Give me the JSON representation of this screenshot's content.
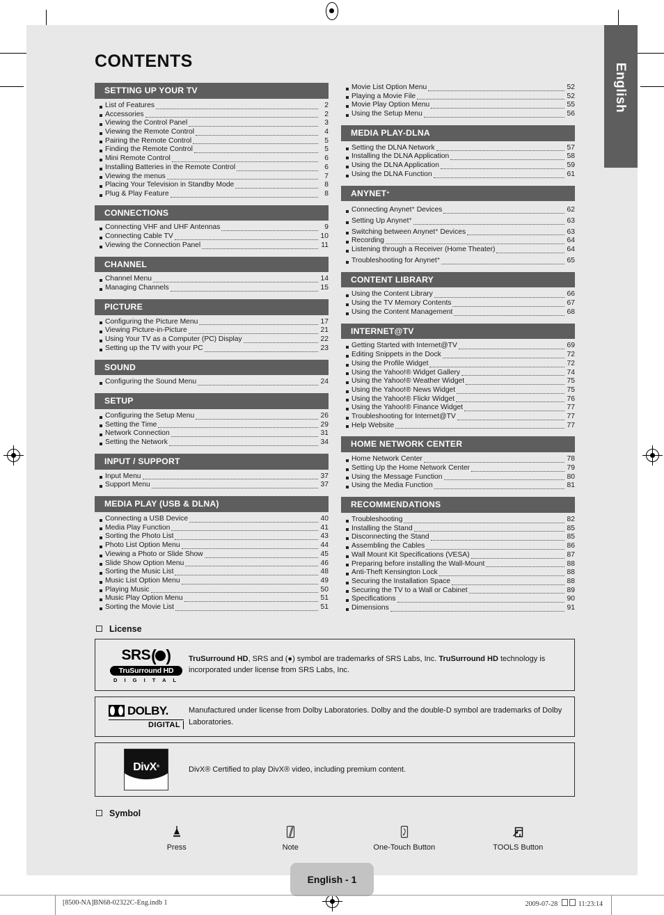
{
  "page": {
    "title": "CONTENTS",
    "language_tab": "English",
    "page_badge": "English - 1"
  },
  "print_footer": {
    "file": "[8500-NA]BN68-02322C-Eng.indb   1",
    "timestamp": "2009-07-28",
    "time": "11:23:14"
  },
  "toc": {
    "left_sections": [
      {
        "heading": "SETTING UP YOUR TV",
        "entries": [
          {
            "label": "List of Features",
            "page": "2"
          },
          {
            "label": "Accessories",
            "page": "2"
          },
          {
            "label": "Viewing the Control Panel",
            "page": "3"
          },
          {
            "label": "Viewing the Remote Control",
            "page": "4"
          },
          {
            "label": "Pairing the Remote Control",
            "page": "5"
          },
          {
            "label": "Finding the Remote Control",
            "page": "5"
          },
          {
            "label": "Mini Remote Control",
            "page": "6"
          },
          {
            "label": "Installing Batteries in the Remote Control",
            "page": "6"
          },
          {
            "label": "Viewing the menus",
            "page": "7"
          },
          {
            "label": "Placing Your Television in Standby Mode",
            "page": "8"
          },
          {
            "label": "Plug & Play Feature",
            "page": "8"
          }
        ]
      },
      {
        "heading": "CONNECTIONS",
        "entries": [
          {
            "label": "Connecting VHF and UHF Antennas",
            "page": "9"
          },
          {
            "label": "Connecting Cable TV",
            "page": "10"
          },
          {
            "label": "Viewing the Connection Panel",
            "page": "11"
          }
        ]
      },
      {
        "heading": "CHANNEL",
        "entries": [
          {
            "label": "Channel Menu",
            "page": "14"
          },
          {
            "label": "Managing Channels",
            "page": "15"
          }
        ]
      },
      {
        "heading": "PICTURE",
        "entries": [
          {
            "label": "Configuring the Picture Menu",
            "page": "17"
          },
          {
            "label": "Viewing Picture-in-Picture",
            "page": "21"
          },
          {
            "label": "Using Your TV as a Computer (PC) Display",
            "page": "22"
          },
          {
            "label": "Setting up the TV with your PC",
            "page": "23"
          }
        ]
      },
      {
        "heading": "SOUND",
        "entries": [
          {
            "label": "Configuring the Sound Menu",
            "page": "24"
          }
        ]
      },
      {
        "heading": "SETUP",
        "entries": [
          {
            "label": "Configuring the Setup Menu",
            "page": "26"
          },
          {
            "label": "Setting the Time",
            "page": "29"
          },
          {
            "label": "Network Connection",
            "page": "31"
          },
          {
            "label": "Setting the Network",
            "page": "34"
          }
        ]
      },
      {
        "heading": "INPUT / SUPPORT",
        "entries": [
          {
            "label": "Input Menu",
            "page": "37"
          },
          {
            "label": "Support Menu",
            "page": "37"
          }
        ]
      },
      {
        "heading": "MEDIA PLAY (USB & DLNA)",
        "entries": [
          {
            "label": "Connecting a USB Device",
            "page": "40"
          },
          {
            "label": "Media Play Function",
            "page": "41"
          },
          {
            "label": "Sorting the Photo List",
            "page": "43"
          },
          {
            "label": "Photo List Option Menu",
            "page": "44"
          },
          {
            "label": "Viewing a Photo or Slide Show",
            "page": "45"
          },
          {
            "label": "Slide Show Option Menu",
            "page": "46"
          },
          {
            "label": "Sorting the Music List",
            "page": "48"
          },
          {
            "label": "Music List Option Menu",
            "page": "49"
          },
          {
            "label": "Playing Music",
            "page": "50"
          },
          {
            "label": "Music Play Option Menu",
            "page": "51"
          },
          {
            "label": "Sorting the Movie List",
            "page": "51"
          }
        ]
      }
    ],
    "right_sections": [
      {
        "heading": null,
        "entries": [
          {
            "label": "Movie List Option Menu",
            "page": "52"
          },
          {
            "label": "Playing a Movie File",
            "page": "52"
          },
          {
            "label": "Movie Play Option Menu",
            "page": "55"
          },
          {
            "label": "Using the Setup Menu",
            "page": "56"
          }
        ]
      },
      {
        "heading": "MEDIA PLAY-DLNA",
        "entries": [
          {
            "label": "Setting the DLNA Network",
            "page": "57"
          },
          {
            "label": "Installing the DLNA Application",
            "page": "58"
          },
          {
            "label": "Using the DLNA Application",
            "page": "59"
          },
          {
            "label": "Using the DLNA Function",
            "page": "61"
          }
        ]
      },
      {
        "heading": "ANYNET+",
        "heading_sup": true,
        "entries": [
          {
            "label": "Connecting Anynet",
            "sup": "+",
            "label2": " Devices",
            "page": "62"
          },
          {
            "label": "Setting Up Anynet",
            "sup": "+",
            "label2": "",
            "page": "63"
          },
          {
            "label": "Switching between Anynet",
            "sup": "+",
            "label2": " Devices",
            "page": "63"
          },
          {
            "label": "Recording",
            "page": "64"
          },
          {
            "label": "Listening through a Receiver (Home Theater)",
            "page": "64"
          },
          {
            "label": "Troubleshooting for Anynet",
            "sup": "+",
            "label2": "",
            "page": "65"
          }
        ]
      },
      {
        "heading": "CONTENT LIBRARY",
        "entries": [
          {
            "label": "Using the Content Library",
            "page": "66"
          },
          {
            "label": "Using the TV Memory Contents",
            "page": "67"
          },
          {
            "label": "Using the Content Management",
            "page": "68"
          }
        ]
      },
      {
        "heading": "INTERNET@TV",
        "entries": [
          {
            "label": "Getting Started with Internet@TV",
            "page": "69"
          },
          {
            "label": "Editing Snippets in the Dock",
            "page": "72"
          },
          {
            "label": "Using the Profile Widget",
            "page": "72"
          },
          {
            "label": "Using the Yahoo!® Widget Gallery",
            "page": "74"
          },
          {
            "label": "Using the Yahoo!® Weather Widget",
            "page": "75"
          },
          {
            "label": "Using the Yahoo!® News Widget",
            "page": "75"
          },
          {
            "label": "Using the Yahoo!® Flickr Widget",
            "page": "76"
          },
          {
            "label": "Using the Yahoo!® Finance Widget",
            "page": "77"
          },
          {
            "label": "Troubleshooting for Internet@TV",
            "page": "77"
          },
          {
            "label": "Help Website",
            "page": "77"
          }
        ]
      },
      {
        "heading": "HOME NETWORK CENTER",
        "entries": [
          {
            "label": "Home Network Center",
            "page": "78"
          },
          {
            "label": "Setting Up the Home Network Center",
            "page": "79"
          },
          {
            "label": "Using the Message Function",
            "page": "80"
          },
          {
            "label": "Using the Media Function",
            "page": "81"
          }
        ]
      },
      {
        "heading": "RECOMMENDATIONS",
        "entries": [
          {
            "label": "Troubleshooting",
            "page": "82"
          },
          {
            "label": "Installing the Stand",
            "page": "85"
          },
          {
            "label": "Disconnecting the Stand",
            "page": "85"
          },
          {
            "label": "Assembling the Cables",
            "page": "86"
          },
          {
            "label": "Wall Mount Kit Specifications (VESA)",
            "page": "87"
          },
          {
            "label": "Preparing before installing the Wall-Mount",
            "page": "88"
          },
          {
            "label": "Anti-Theft Kensington Lock",
            "page": "88"
          },
          {
            "label": "Securing the Installation Space",
            "page": "88"
          },
          {
            "label": "Securing the TV to a Wall or Cabinet",
            "page": "89"
          },
          {
            "label": "Specifications",
            "page": "90"
          },
          {
            "label": "Dimensions",
            "page": "91"
          }
        ]
      }
    ]
  },
  "license": {
    "title": "License",
    "items": [
      {
        "logo": "srs-trusurround-hd-digital-logo",
        "logo_text": {
          "main": "SRS",
          "mid": "TruSurround HD",
          "bottom": "D I G I T A L"
        },
        "text_html": "<b>TruSurround HD</b>, SRS and (&#9679;) symbol are trademarks of SRS Labs, Inc. <b>TruSurround HD</b> technology is incorporated under license from SRS Labs, Inc."
      },
      {
        "logo": "dolby-digital-logo",
        "logo_text": {
          "main": "DOLBY.",
          "bottom": "DIGITAL"
        },
        "text_html": "Manufactured under license from Dolby Laboratories. Dolby and the double-D symbol are trademarks of Dolby Laboratories."
      },
      {
        "logo": "divx-logo",
        "logo_text": {
          "main": "DivX"
        },
        "text_html": "DivX&#174; Certified to play DivX&#174; video, including premium content."
      }
    ]
  },
  "symbol": {
    "title": "Symbol",
    "items": [
      {
        "icon": "press-arrow-icon",
        "label": "Press"
      },
      {
        "icon": "note-pencil-icon",
        "label": "Note"
      },
      {
        "icon": "one-touch-button-icon",
        "label": "One-Touch Button"
      },
      {
        "icon": "tools-button-icon",
        "label": "TOOLS Button"
      }
    ]
  },
  "colors": {
    "section_header_bg": "#5e5e5e",
    "sheet_bg": "#e8e8e8",
    "badge_bg": "#c3c3c3",
    "text": "#1a1a1a"
  }
}
